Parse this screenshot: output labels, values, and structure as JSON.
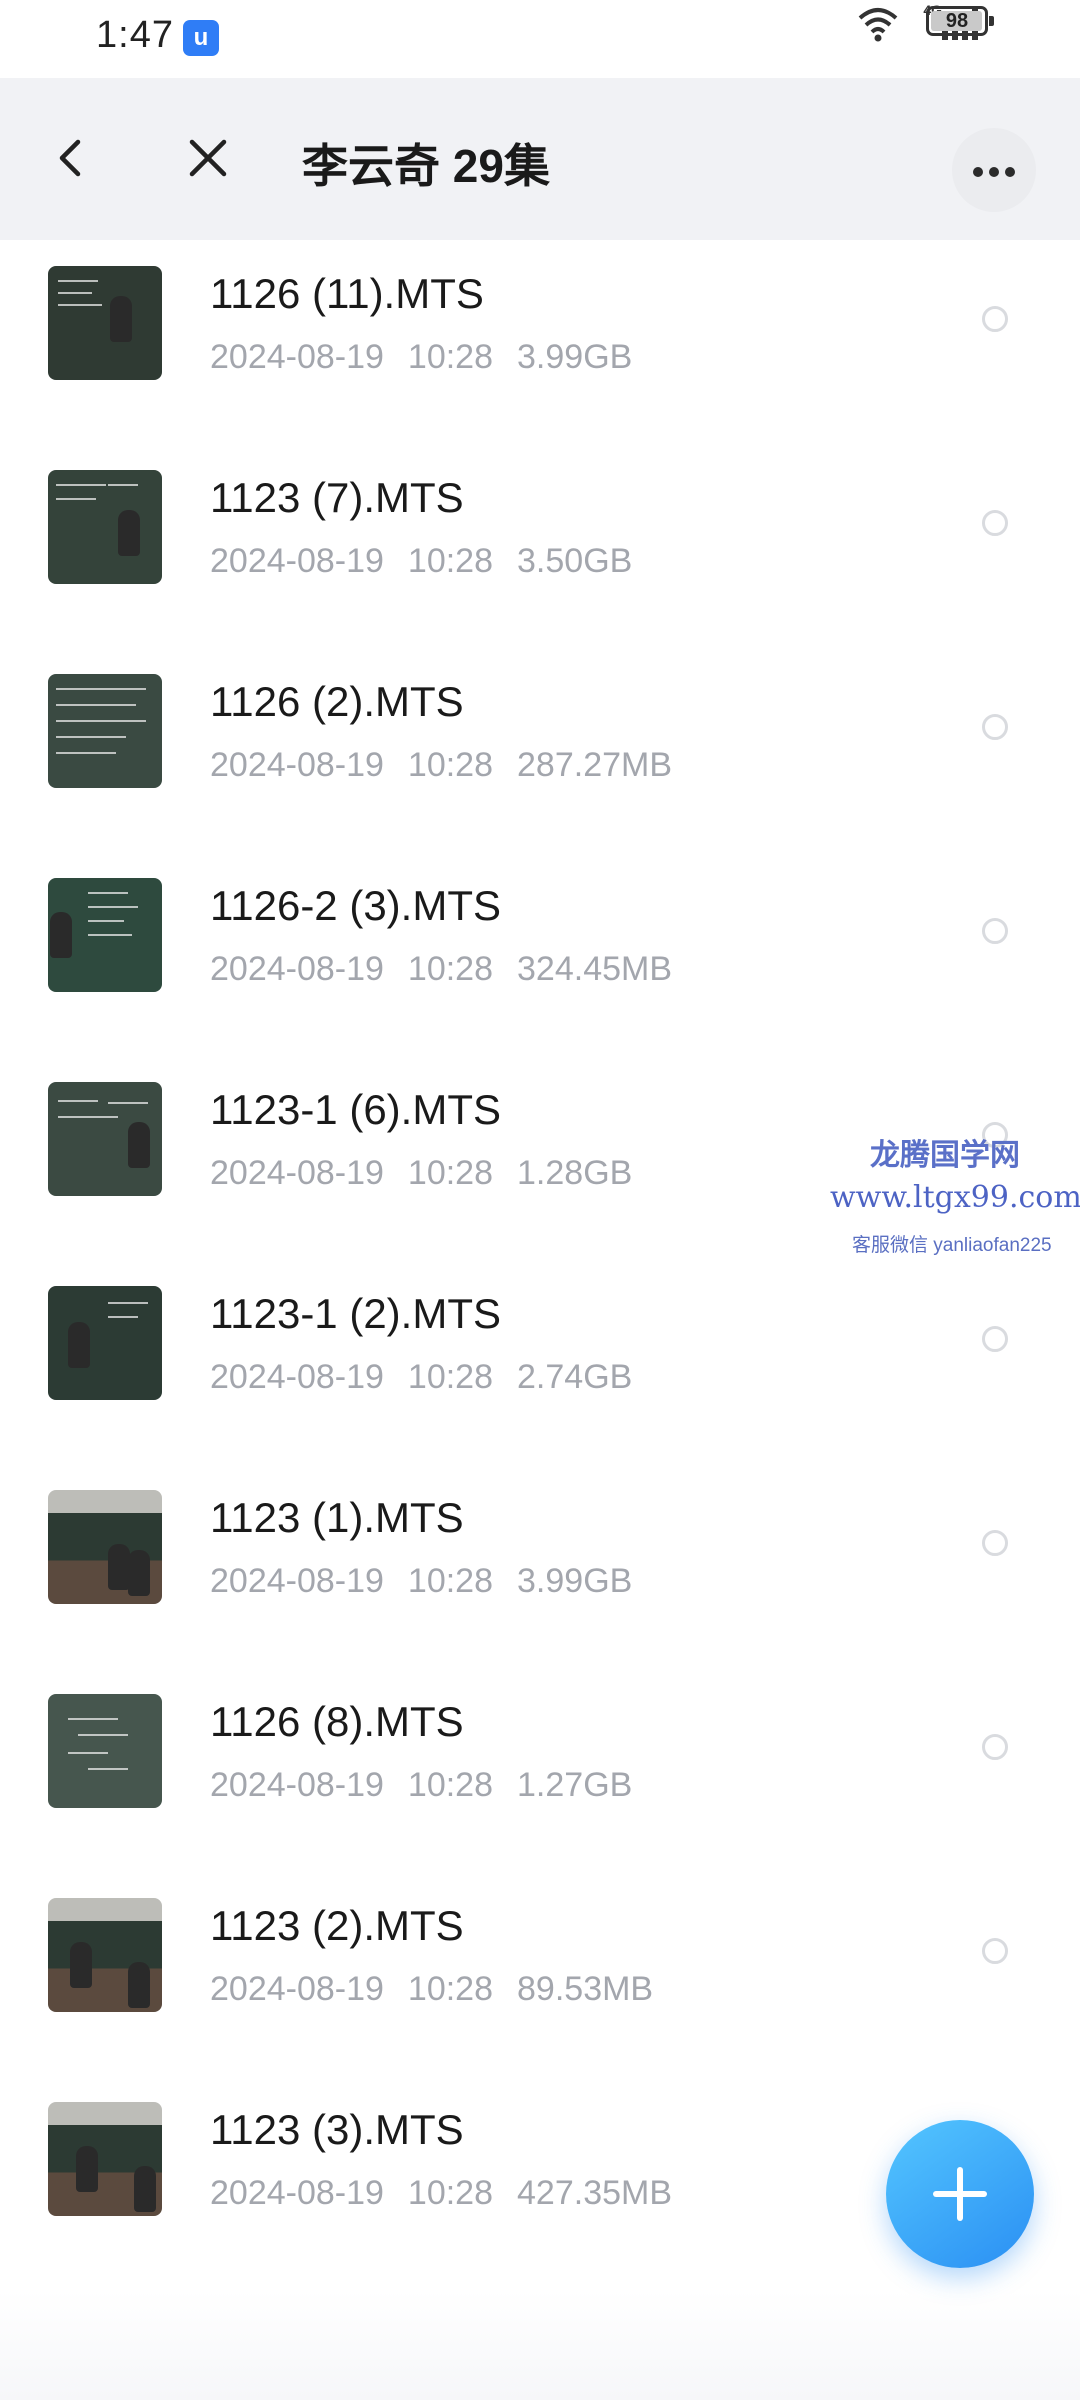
{
  "status_bar": {
    "time": "1:47",
    "app_badge": "u",
    "network": "4G",
    "battery": "98",
    "battery_level": 0.98
  },
  "header": {
    "title": "李云奇 29集",
    "back_icon": "chevron-left-icon",
    "close_icon": "close-icon",
    "more_icon": "more-horizontal-icon"
  },
  "files": [
    {
      "name": "1126 (11).MTS",
      "date": "2024-08-19",
      "time": "10:28",
      "size": "3.99GB"
    },
    {
      "name": "1123 (7).MTS",
      "date": "2024-08-19",
      "time": "10:28",
      "size": "3.50GB"
    },
    {
      "name": "1126 (2).MTS",
      "date": "2024-08-19",
      "time": "10:28",
      "size": "287.27MB"
    },
    {
      "name": "1126-2 (3).MTS",
      "date": "2024-08-19",
      "time": "10:28",
      "size": "324.45MB"
    },
    {
      "name": "1123-1 (6).MTS",
      "date": "2024-08-19",
      "time": "10:28",
      "size": "1.28GB"
    },
    {
      "name": "1123-1 (2).MTS",
      "date": "2024-08-19",
      "time": "10:28",
      "size": "2.74GB"
    },
    {
      "name": "1123 (1).MTS",
      "date": "2024-08-19",
      "time": "10:28",
      "size": "3.99GB"
    },
    {
      "name": "1126 (8).MTS",
      "date": "2024-08-19",
      "time": "10:28",
      "size": "1.27GB"
    },
    {
      "name": "1123 (2).MTS",
      "date": "2024-08-19",
      "time": "10:28",
      "size": "89.53MB"
    },
    {
      "name": "1123 (3).MTS",
      "date": "2024-08-19",
      "time": "10:28",
      "size": "427.35MB"
    }
  ],
  "watermark": {
    "name": "龙腾国学网",
    "url": "www.ltgx99.com",
    "contact": "客服微信 yanliaofan225"
  },
  "fab": {
    "icon": "plus-icon"
  },
  "colors": {
    "header_bg": "#f1f2f5",
    "meta_text": "#a3a6ad",
    "fab_accent": "#2a8ff3",
    "watermark": "#4d63c4"
  }
}
